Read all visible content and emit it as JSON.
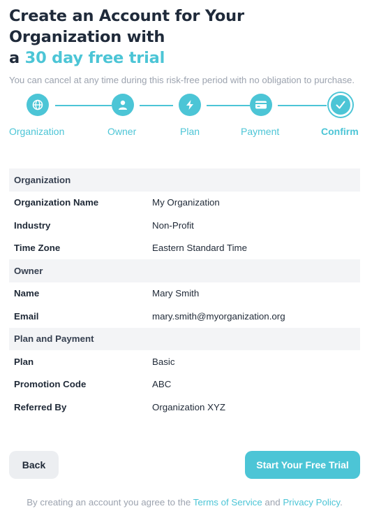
{
  "header": {
    "title_line1": "Create an Account for Your Organization with",
    "title_prefix": "a ",
    "title_accent": "30 day free trial",
    "subtitle": "You can cancel at any time during this risk-free period with no obligation to purchase."
  },
  "colors": {
    "accent": "#4cc5d6",
    "text_dark": "#1f2a3a",
    "muted": "#9ca3af",
    "section_bg": "#f3f4f6"
  },
  "stepper": {
    "steps": [
      {
        "label": "Organization",
        "icon": "globe-icon"
      },
      {
        "label": "Owner",
        "icon": "user-icon"
      },
      {
        "label": "Plan",
        "icon": "bolt-icon"
      },
      {
        "label": "Payment",
        "icon": "credit-card-icon"
      },
      {
        "label": "Confirm",
        "icon": "check-icon",
        "active": true
      }
    ]
  },
  "summary": {
    "organization": {
      "heading": "Organization",
      "rows": [
        {
          "label": "Organization Name",
          "value": "My Organization"
        },
        {
          "label": "Industry",
          "value": "Non-Profit"
        },
        {
          "label": "Time Zone",
          "value": "Eastern Standard Time"
        }
      ]
    },
    "owner": {
      "heading": "Owner",
      "rows": [
        {
          "label": "Name",
          "value": "Mary Smith"
        },
        {
          "label": "Email",
          "value": "mary.smith@myorganization.org"
        }
      ]
    },
    "plan": {
      "heading": "Plan and Payment",
      "rows": [
        {
          "label": "Plan",
          "value": "Basic"
        },
        {
          "label": "Promotion Code",
          "value": "ABC"
        },
        {
          "label": "Referred By",
          "value": "Organization XYZ"
        }
      ]
    }
  },
  "actions": {
    "back_label": "Back",
    "start_label": "Start Your Free Trial"
  },
  "legal": {
    "prefix": "By creating an account you agree to the ",
    "terms": "Terms of Service",
    "and": " and ",
    "privacy": "Privacy Policy",
    "suffix": "."
  }
}
